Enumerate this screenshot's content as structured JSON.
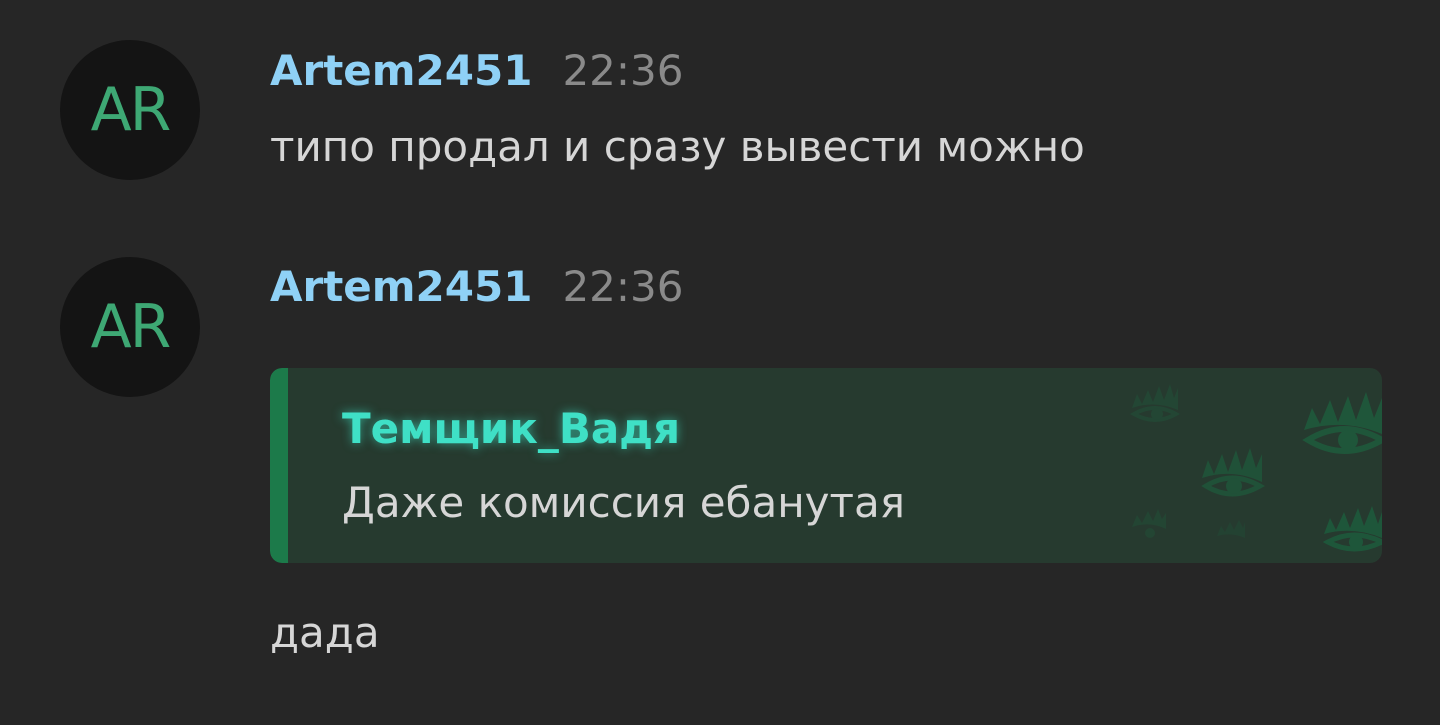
{
  "messages": [
    {
      "avatar_initials": "AR",
      "author": "Artem2451",
      "time": "22:36",
      "text": "типо продал и сразу вывести можно"
    },
    {
      "avatar_initials": "AR",
      "author": "Artem2451",
      "time": "22:36",
      "reply": {
        "author": "Темщик_Вадя",
        "text": "Даже комиссия ебанутая",
        "decor_icon": "eye-pattern-icon"
      },
      "text": "дада"
    }
  ],
  "colors": {
    "background": "#262626",
    "avatar_bg": "#141414",
    "avatar_text": "#3ea874",
    "author": "#8fd1f6",
    "time": "#8a8a8a",
    "text": "#d6d6d6",
    "reply_bg": "#263a2f",
    "reply_bar": "#1c7a4a",
    "reply_author": "#3fe0c6"
  }
}
